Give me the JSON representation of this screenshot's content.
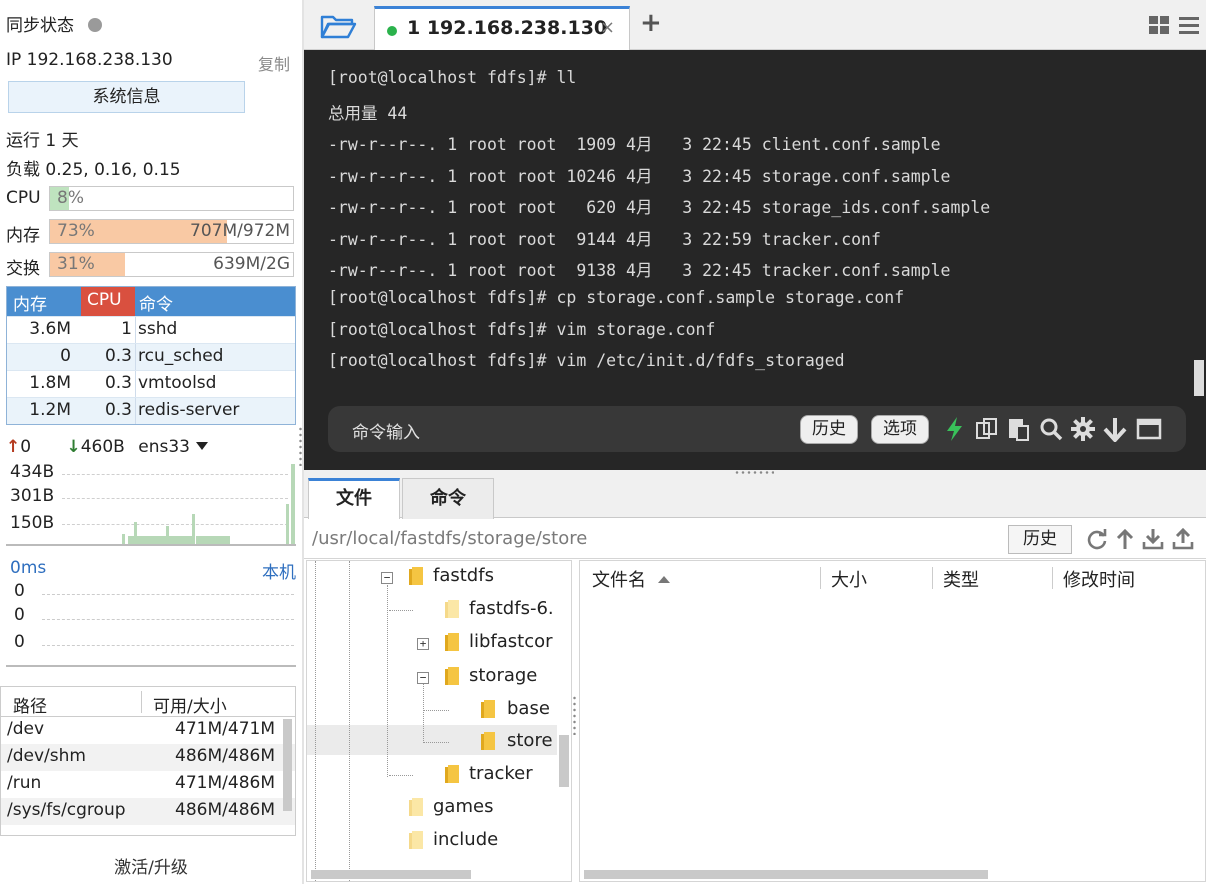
{
  "left": {
    "sync_status": "同步状态",
    "ip_label": "IP 192.168.238.130",
    "copy": "复制",
    "sysinfo_button": "系统信息",
    "uptime": "运行 1 天",
    "load": "负载 0.25, 0.16, 0.15",
    "cpu": {
      "label": "CPU",
      "percent_text": "8%",
      "fraction": 0.08
    },
    "mem": {
      "label": "内存",
      "percent_text": "73%",
      "amount": "707M/972M",
      "fraction": 0.73
    },
    "swap": {
      "label": "交换",
      "percent_text": "31%",
      "amount": "639M/2G",
      "fraction": 0.31
    },
    "proc_table": {
      "headers": [
        "内存",
        "CPU",
        "命令"
      ],
      "rows": [
        {
          "mem": "3.6M",
          "cpu": "1",
          "cmd": "sshd"
        },
        {
          "mem": "0",
          "cpu": "0.3",
          "cmd": "rcu_sched"
        },
        {
          "mem": "1.8M",
          "cpu": "0.3",
          "cmd": "vmtoolsd"
        },
        {
          "mem": "1.2M",
          "cpu": "0.3",
          "cmd": "redis-server"
        }
      ]
    },
    "net": {
      "up_value": "0",
      "down_value": "460B",
      "iface": "ens33",
      "scale_labels": [
        "434B",
        "301B",
        "150B"
      ]
    },
    "ping": {
      "latency": "0ms",
      "host": "本机",
      "values": [
        "0",
        "0",
        "0"
      ]
    },
    "disk_table": {
      "headers": [
        "路径",
        "可用/大小"
      ],
      "rows": [
        {
          "path": "/dev",
          "avail": "471M/471M"
        },
        {
          "path": "/dev/shm",
          "avail": "486M/486M"
        },
        {
          "path": "/run",
          "avail": "471M/486M"
        },
        {
          "path": "/sys/fs/cgroup",
          "avail": "486M/486M"
        }
      ]
    },
    "activate": "激活/升级"
  },
  "tabs": {
    "active_tab": "1 192.168.238.130",
    "close_glyph": "×",
    "add_glyph": "+"
  },
  "terminal": {
    "lines": [
      "[root@localhost fdfs]# ll",
      "总用量 44",
      "-rw-r--r--. 1 root root  1909 4月   3 22:45 client.conf.sample",
      "-rw-r--r--. 1 root root 10246 4月   3 22:45 storage.conf.sample",
      "-rw-r--r--. 1 root root   620 4月   3 22:45 storage_ids.conf.sample",
      "-rw-r--r--. 1 root root  9144 4月   3 22:59 tracker.conf",
      "-rw-r--r--. 1 root root  9138 4月   3 22:45 tracker.conf.sample",
      "[root@localhost fdfs]# cp storage.conf.sample storage.conf",
      "[root@localhost fdfs]# vim storage.conf",
      "[root@localhost fdfs]# vim /etc/init.d/fdfs_storaged"
    ],
    "command_placeholder": "命令输入",
    "history_button": "历史",
    "options_button": "选项"
  },
  "files": {
    "tab_files": "文件",
    "tab_commands": "命令",
    "path": "/usr/local/fastdfs/storage/store",
    "history_button": "历史",
    "tree": {
      "fastdfs": "fastdfs",
      "fastdfs6": "fastdfs-6.",
      "libfastcommon": "libfastcor",
      "storage": "storage",
      "base": "base",
      "store": "store",
      "tracker": "tracker",
      "games": "games",
      "include": "include"
    },
    "columns": [
      "文件名",
      "大小",
      "类型",
      "修改时间"
    ]
  },
  "colors": {
    "accent_blue": "#3b82d6",
    "cpu_fill": "#bfe3bf",
    "mem_fill": "#f9c9a4",
    "proc_header": "#4a8ed0",
    "cpu_header": "#d9503f",
    "terminal_bg": "#262626",
    "online_dot": "#2bb24c",
    "folder_yellow": "#f5c542"
  }
}
